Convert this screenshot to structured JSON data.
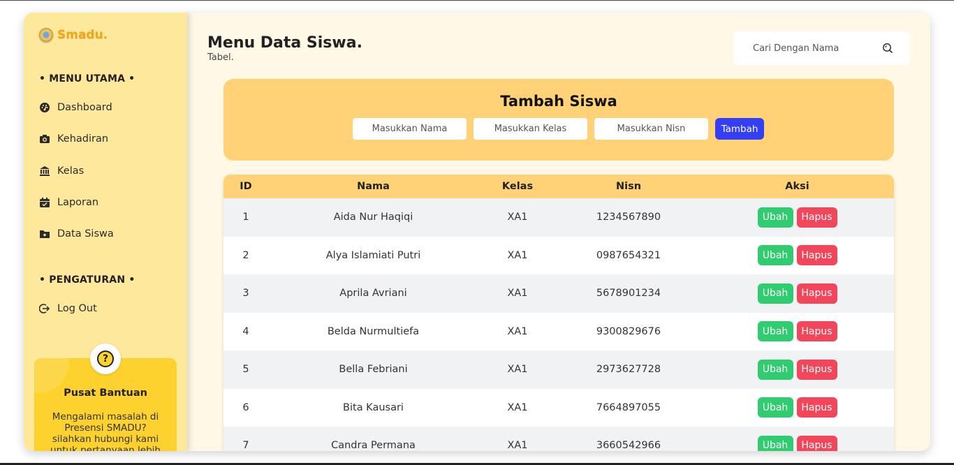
{
  "brand": {
    "name": "Smadu."
  },
  "sidebar": {
    "main_section": "• MENU UTAMA •",
    "items": [
      {
        "label": "Dashboard",
        "icon": "dashboard-gauge-icon"
      },
      {
        "label": "Kehadiran",
        "icon": "camera-icon"
      },
      {
        "label": "Kelas",
        "icon": "building-columns-icon"
      },
      {
        "label": "Laporan",
        "icon": "calendar-check-icon"
      },
      {
        "label": "Data Siswa",
        "icon": "folder-plus-icon"
      }
    ],
    "settings_section": "• PENGATURAN •",
    "logout": {
      "label": "Log Out",
      "icon": "logout-icon"
    },
    "help": {
      "title": "Pusat Bantuan",
      "text": "Mengalami masalah di Presensi SMADU? silahkan hubungi kami untuk pertanyaan lebih"
    }
  },
  "header": {
    "title": "Menu Data Siswa.",
    "subtitle": "Tabel.",
    "search_placeholder": "Cari Dengan Nama"
  },
  "add_form": {
    "title": "Tambah Siswa",
    "name_placeholder": "Masukkan Nama",
    "class_placeholder": "Masukkan Kelas",
    "nisn_placeholder": "Masukkan Nisn",
    "submit_label": "Tambah"
  },
  "table": {
    "columns": [
      "ID",
      "Nama",
      "Kelas",
      "Nisn",
      "Aksi"
    ],
    "edit_label": "Ubah",
    "delete_label": "Hapus",
    "rows": [
      {
        "id": "1",
        "nama": "Aida Nur Haqiqi",
        "kelas": "XA1",
        "nisn": "1234567890"
      },
      {
        "id": "2",
        "nama": "Alya Islamiati Putri",
        "kelas": "XA1",
        "nisn": "0987654321"
      },
      {
        "id": "3",
        "nama": "Aprila Avriani",
        "kelas": "XA1",
        "nisn": "5678901234"
      },
      {
        "id": "4",
        "nama": "Belda Nurmultiefa",
        "kelas": "XA1",
        "nisn": "9300829676"
      },
      {
        "id": "5",
        "nama": "Bella Febriani",
        "kelas": "XA1",
        "nisn": "2973627728"
      },
      {
        "id": "6",
        "nama": "Bita Kausari",
        "kelas": "XA1",
        "nisn": "7664897055"
      },
      {
        "id": "7",
        "nama": "Candra Permana",
        "kelas": "XA1",
        "nisn": "3660542966"
      }
    ]
  }
}
